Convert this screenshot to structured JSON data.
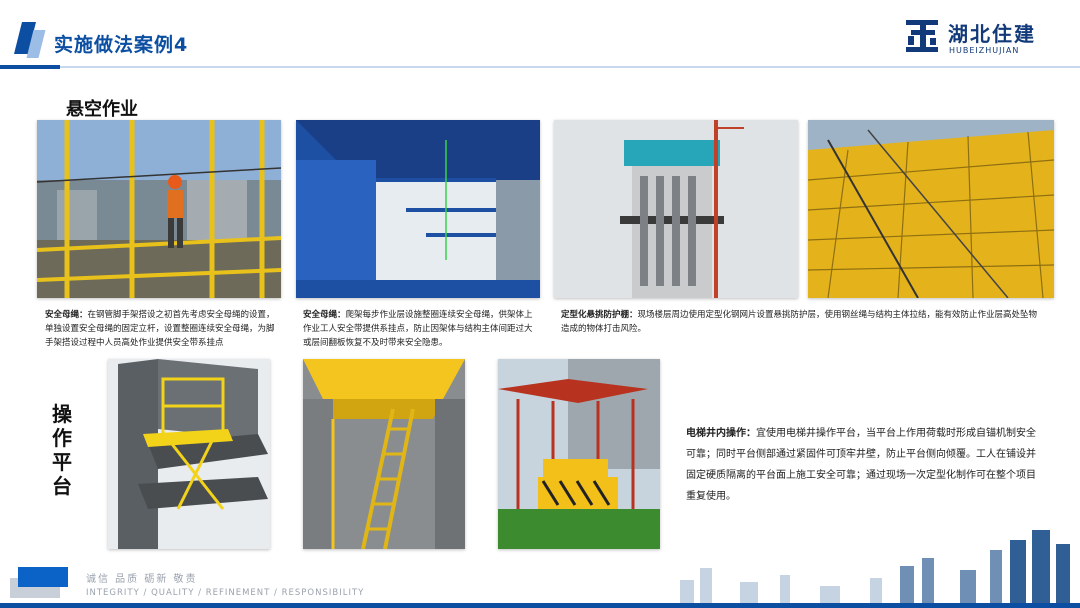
{
  "header": {
    "title": "实施做法案例4",
    "logo_cn": "湖北住建",
    "logo_en": "HUBEIZHUJIAN"
  },
  "sections": {
    "aerial": "悬空作业",
    "platform": "操作平台"
  },
  "captions": {
    "c1": {
      "head": "安全母绳：",
      "body": "在钢管脚手架搭设之初首先考虑安全母绳的设置，单独设置安全母绳的固定立杆，设置整圈连续安全母绳，为脚手架搭设过程中人员高处作业提供安全带系挂点"
    },
    "c2": {
      "head": "安全母绳：",
      "body": "爬架每步作业层设施整圈连续安全母绳，供架体上作业工人安全带提供系挂点，防止因架体与结构主体间距过大或层间翻板恢复不及时带来安全隐患。"
    },
    "c3": {
      "head": "定型化悬挑防护棚：",
      "body": "现场楼层周边使用定型化钢网片设置悬挑防护层，使用钢丝绳与结构主体拉结，能有效防止作业层高处坠物造成的物体打击风险。"
    },
    "c4": {
      "head": "电梯井内操作：",
      "body": "宜使用电梯井操作平台，当平台上作用荷载时形成自锚机制安全可靠；同时平台侧部通过紧固件可顶牢井壁，防止平台侧向倾覆。工人在铺设并固定硬质隔离的平台面上施工安全可靠；通过现场一次定型化制作可在整个项目重复使用。"
    }
  },
  "footer": {
    "cn": "诚信 品质 砺新 敬责",
    "en": "INTEGRITY / QUALITY / REFINEMENT / RESPONSIBILITY"
  },
  "colors": {
    "brand_blue": "#0b4ea2",
    "accent_yellow": "#f2c018"
  },
  "icons": {
    "logo": "hubei-zhujian-logo-icon"
  }
}
